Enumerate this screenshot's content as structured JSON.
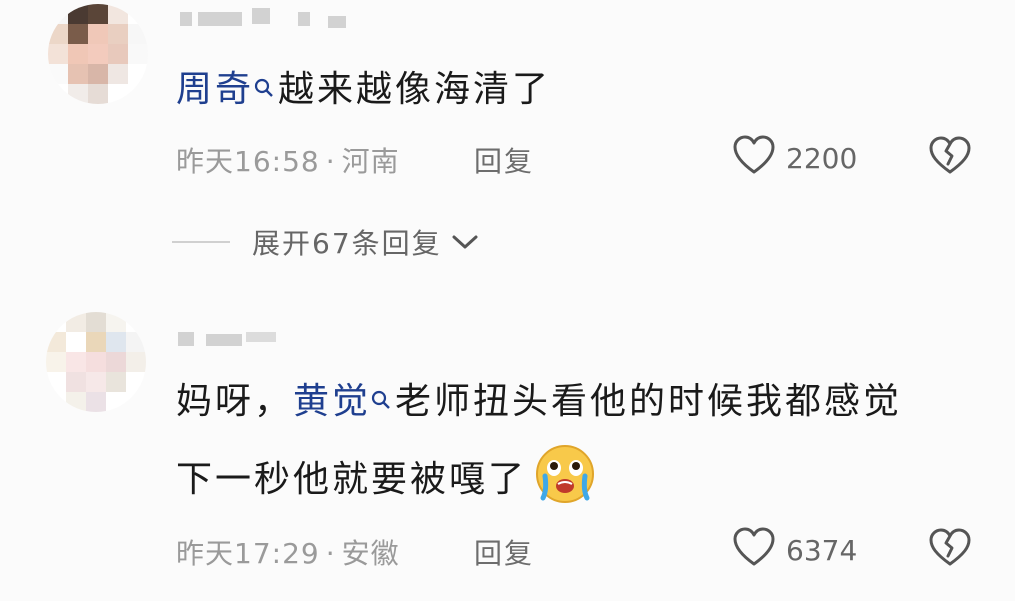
{
  "comments": [
    {
      "avatar_colors": [
        [
          "#f6f6f6",
          "#4a3a32",
          "#5a4538",
          "#f2e6df",
          "#ffffff"
        ],
        [
          "#ecd7c8",
          "#7a5c4a",
          "#f0c8b8",
          "#e9cfc1",
          "#f7f7f7"
        ],
        [
          "#f3e2d8",
          "#f0c7b6",
          "#f3cbbd",
          "#e8c9bc",
          "#f9f9f9"
        ],
        [
          "#fafafa",
          "#e6c2b2",
          "#d8b6a8",
          "#efe7e3",
          "#ffffff"
        ],
        [
          "#ffffff",
          "#f1ece9",
          "#e6dcd6",
          "#ffffff",
          "#ffffff"
        ]
      ],
      "mention": "周奇",
      "text": "越来越像海清了",
      "timestamp": "昨天16:58",
      "separator": "·",
      "location": "河南",
      "reply_label": "回复",
      "likes": "2200"
    },
    {
      "avatar_colors": [
        [
          "#ffffff",
          "#f2ece4",
          "#e3ddd4",
          "#f6f4ef",
          "#ffffff"
        ],
        [
          "#f3e9da",
          "#ffffff",
          "#ead7b9",
          "#dfe6ee",
          "#f4f4f4"
        ],
        [
          "#f8f3ea",
          "#f9e6e6",
          "#f5dede",
          "#ecd8d8",
          "#f3efe9"
        ],
        [
          "#ffffff",
          "#f0e1e1",
          "#f6e8e8",
          "#e9e4dc",
          "#ffffff"
        ],
        [
          "#ffffff",
          "#f4f1ea",
          "#ebe1e6",
          "#ffffff",
          "#ffffff"
        ]
      ],
      "line1_prefix": "妈呀，",
      "mention": "黄觉",
      "line1_suffix": "老师扭头看他的时候我都感觉",
      "line2": "下一秒他就要被嘎了",
      "emoji": "crying-face-emoji",
      "timestamp": "昨天17:29",
      "separator": "·",
      "location": "安徽",
      "reply_label": "回复",
      "likes": "6374"
    }
  ],
  "expand_replies": {
    "label": "展开67条回复"
  },
  "colors": {
    "mention": "#1f3f8f",
    "meta": "#9a9a9a",
    "background": "#fbfbfb"
  }
}
